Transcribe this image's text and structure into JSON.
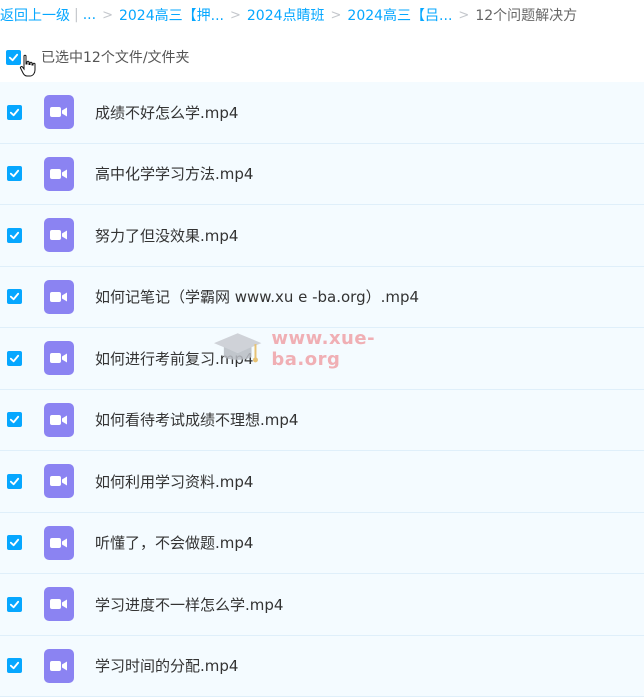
{
  "breadcrumb": {
    "back": "返回上一级",
    "ellipsis": "...",
    "crumbs": [
      "2024高三【押...",
      "2024点睛班",
      "2024高三【吕..."
    ],
    "current": "12个问题解决方"
  },
  "selection": {
    "label": "已选中12个文件/文件夹"
  },
  "files": [
    {
      "name": "成绩不好怎么学.mp4"
    },
    {
      "name": "高中化学学习方法.mp4"
    },
    {
      "name": "努力了但没效果.mp4"
    },
    {
      "name": "如何记笔记（学霸网 www.xu e -ba.org）.mp4"
    },
    {
      "name": "如何进行考前复习.mp4"
    },
    {
      "name": "如何看待考试成绩不理想.mp4"
    },
    {
      "name": "如何利用学习资料.mp4"
    },
    {
      "name": "听懂了，不会做题.mp4"
    },
    {
      "name": "学习进度不一样怎么学.mp4"
    },
    {
      "name": "学习时间的分配.mp4"
    }
  ],
  "watermark": {
    "text": "www.xue-ba.org"
  },
  "colors": {
    "accent": "#06a7ff",
    "video_icon": "#8b83f2",
    "row_bg": "#f4fbff"
  }
}
